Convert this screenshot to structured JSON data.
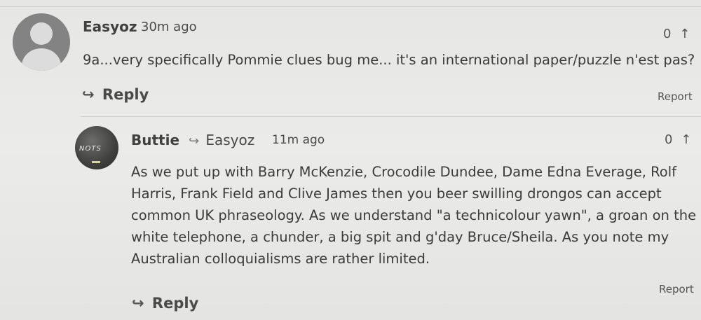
{
  "comment1": {
    "username": "Easyoz",
    "time": "30m ago",
    "votes": "0",
    "body": "9a...very specifically Pommie clues bug me... it's an international paper/puzzle n'est pas?",
    "reply_label": "Reply",
    "report_label": "Report"
  },
  "comment2": {
    "username": "Buttie",
    "reply_to": "Easyoz",
    "time": "11m ago",
    "votes": "0",
    "avatar_text": "NOTS",
    "body_lines": [
      "As we put up with Barry McKenzie, Crocodile Dundee, Dame Edna Everage, Rolf",
      "Harris, Frank Field and Clive James then you beer swilling drongos can accept",
      "common UK phraseology. As we understand \"a technicolour yawn\", a groan on the",
      "white telephone, a chunder, a big spit and g'day Bruce/Sheila. As you note my",
      "Australian colloquialisms are rather limited."
    ],
    "reply_label": "Reply",
    "report_label": "Report"
  },
  "icons": {
    "reply_arrow": "↪",
    "upvote_arrow": "↑"
  }
}
